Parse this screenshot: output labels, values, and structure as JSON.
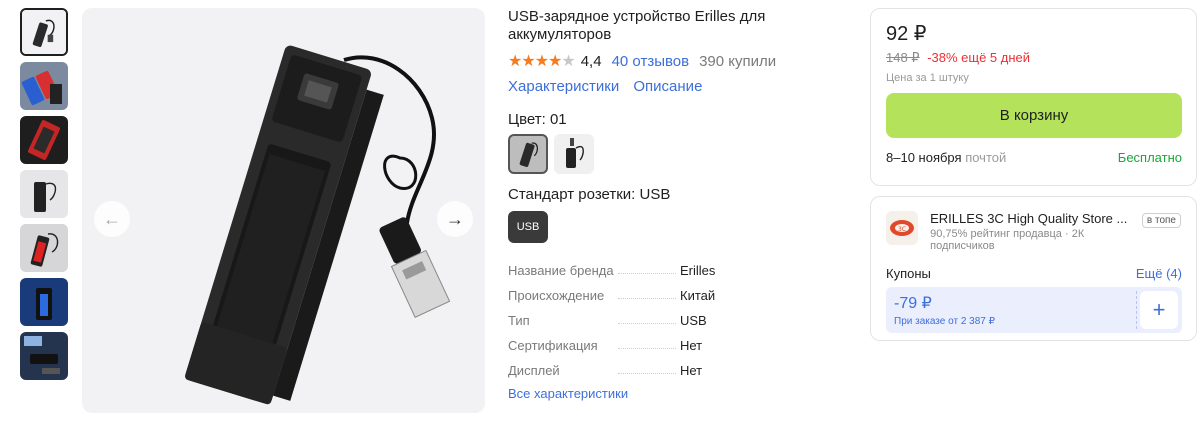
{
  "product": {
    "title": "USB-зарядное устройство Erilles для аккумуляторов",
    "rating": "4,4",
    "stars": "★★★★",
    "star_half": "★",
    "reviews": "40 отзывов",
    "bought": "390 купили",
    "links": [
      "Характеристики",
      "Описание"
    ],
    "color_label": "Цвет: 01",
    "socket_label": "Стандарт розетки: USB",
    "socket_option": "USB",
    "specs": [
      {
        "name": "Название бренда",
        "value": "Erilles"
      },
      {
        "name": "Происхождение",
        "value": "Китай"
      },
      {
        "name": "Тип",
        "value": "USB"
      },
      {
        "name": "Сертификация",
        "value": "Нет"
      },
      {
        "name": "Дисплей",
        "value": "Нет"
      }
    ],
    "all_specs": "Все характеристики"
  },
  "gallery": {
    "prev_icon": "←",
    "next_icon": "→"
  },
  "price_card": {
    "price": "92 ₽",
    "old_price": "148 ₽",
    "discount": "-38% ещё 5 дней",
    "unit": "Цена за 1 штуку",
    "cart_button": "В корзину",
    "delivery_date": "8–10 ноября",
    "delivery_by": "почтой",
    "delivery_price": "Бесплатно"
  },
  "store": {
    "name": "ERILLES 3C High Quality Store ...",
    "badge": "в топе",
    "meta": "90,75% рейтинг продавца · 2К подписчиков",
    "coupons_label": "Купоны",
    "coupons_more": "Ещё (4)",
    "coupon_amount": "-79 ₽",
    "coupon_condition": "При заказе от 2 387 ₽",
    "coupon_add": "+"
  },
  "colors": {
    "accent_link": "#3d6fd9",
    "cart": "#b4e35b",
    "discount": "#ec3033",
    "free": "#1aa63a",
    "stars": "#f57c1f"
  }
}
